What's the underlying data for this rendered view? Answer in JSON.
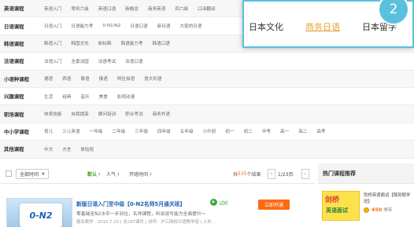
{
  "categories": [
    {
      "name": "英语课程",
      "items": [
        "英语入门",
        "零到六级",
        "英语口语",
        "新概念",
        "商务英语",
        "四六级",
        "口译翻译"
      ]
    },
    {
      "name": "日语课程",
      "items": [
        "日语入门",
        "日语能力考",
        "0-N1/N2",
        "日语口语",
        "新日语",
        "大家的日语"
      ]
    },
    {
      "name": "韩语课程",
      "items": [
        "韩语入门",
        "韩国文化",
        "新标韩",
        "韩语能力考",
        "韩语口语"
      ]
    },
    {
      "name": "法语课程",
      "items": [
        "法语入门",
        "全景法国",
        "法语考试",
        "法语口语"
      ]
    },
    {
      "name": "小语种课程",
      "items": [
        "德语",
        "西语",
        "泰语",
        "俄语",
        "阿拉伯语",
        "意大利语"
      ]
    },
    {
      "name": "兴趣课程",
      "items": [
        "生活",
        "经典",
        "音乐",
        "美食",
        "影视动漫"
      ]
    },
    {
      "name": "职场课程",
      "items": [
        "效率技能",
        "自我提高",
        "顾问培训",
        "职业考试",
        "商务外语"
      ]
    },
    {
      "name": "中小学课程",
      "items": [
        "育儿",
        "少儿英语",
        "一年级",
        "二年级",
        "三年级",
        "四年级",
        "五年级",
        "小升初",
        "初一",
        "初二",
        "中考",
        "高一",
        "高二",
        "高考"
      ]
    },
    {
      "name": "其他课程",
      "items": [
        "中文",
        "方言",
        "体验班"
      ]
    }
  ],
  "toolbar": {
    "time_select": "全部时间",
    "sorts": [
      "默认",
      "人气",
      "开班时间"
    ],
    "count_prefix": "共",
    "count_num": "535",
    "count_suffix": "个结果",
    "page": "1/23页",
    "prev": "‹",
    "next": "›"
  },
  "course": {
    "thumb_logo": "0-N2",
    "title": "新版日语入门至中级【0-N2名师5月通关班】",
    "try_label": "试听",
    "desc": "零基础至N2水平一步到位，名师课程，听说读写能力全面提升～",
    "meta": "报名数学 · 2015.7.15 | 总297课时 | 讲师：沪江网校日语教学组 | 上外...",
    "enroll": "立即开通"
  },
  "hot": {
    "title": "热门课程推荐",
    "thumb_line1": "剑桥",
    "thumb_line2": "英语面试",
    "course": "剑桥英语面试【随到随学班】",
    "price": "450",
    "unit": "学币"
  },
  "popup": {
    "items": [
      "日本文化",
      "商务日语",
      "日本留学"
    ],
    "badge": "2"
  },
  "colors": {
    "accent": "#5bc0de",
    "orange": "#ff6a13",
    "link": "#1f61b4"
  }
}
